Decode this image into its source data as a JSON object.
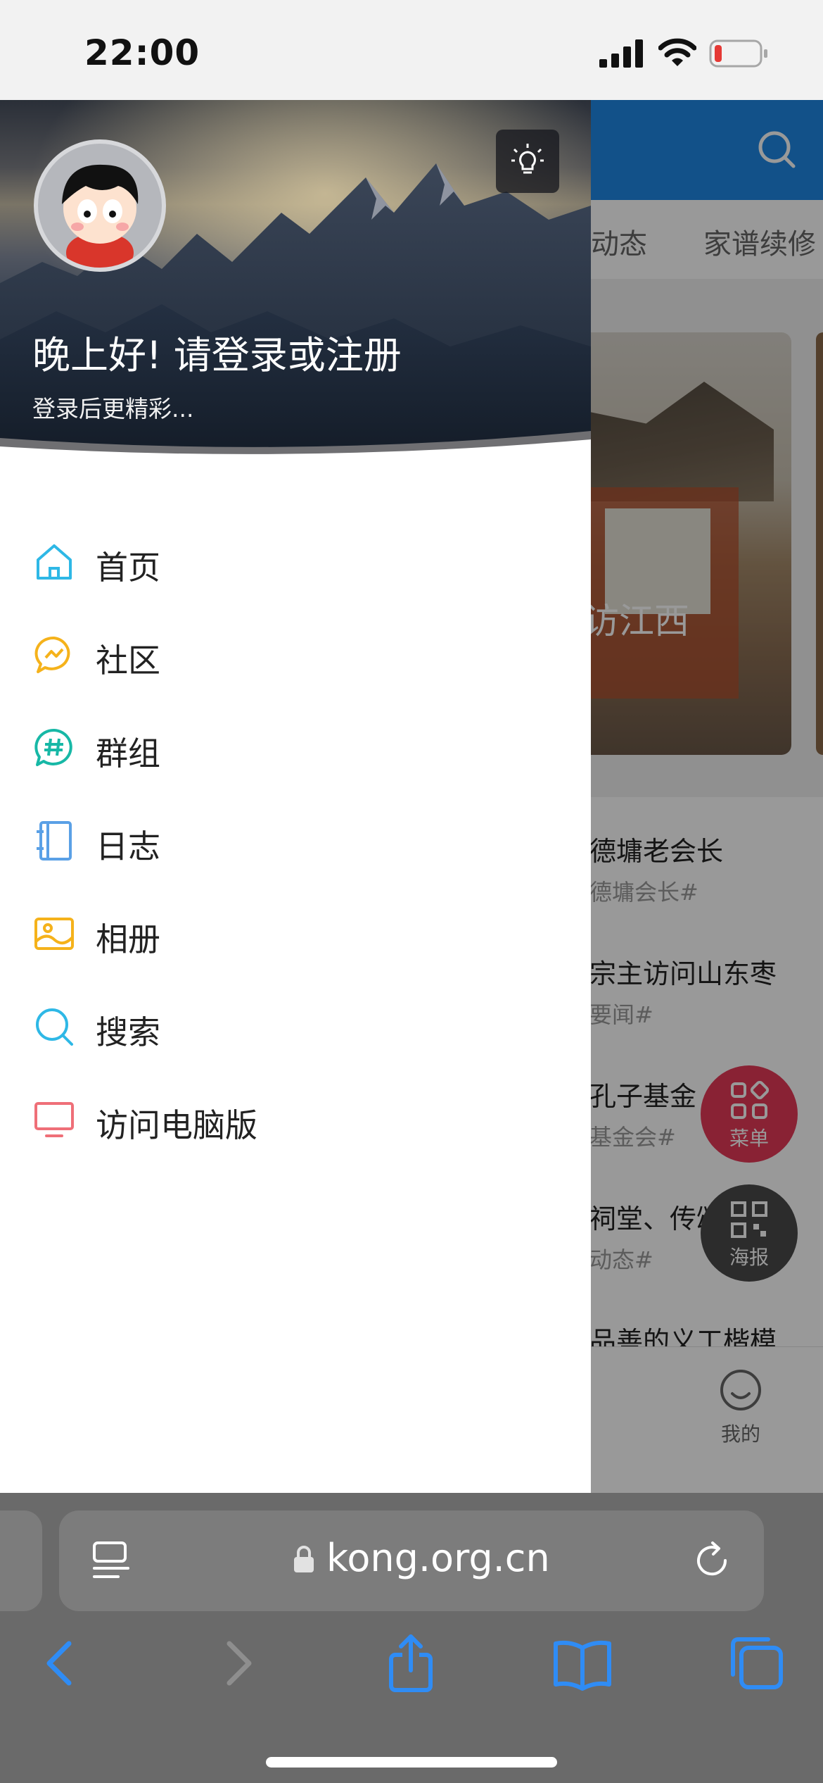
{
  "status_bar": {
    "time": "22:00"
  },
  "background_page": {
    "tabs": [
      "动态",
      "家谱续修"
    ],
    "banner_caption": "立到访江西",
    "news": [
      {
        "title": "德墉老会长",
        "tag": "德墉会长#"
      },
      {
        "title": "宗主访问山东枣",
        "tag": "要闻#"
      },
      {
        "title": "孔子基金",
        "tag": "基金会#"
      },
      {
        "title": "祠堂、传颂家风",
        "tag": "动态#"
      },
      {
        "title": "品善的义工楷模",
        "tag": ""
      }
    ],
    "bottom_nav": {
      "mine_label": "我的"
    },
    "fab_menu_label": "菜单",
    "fab_poster_label": "海报"
  },
  "drawer": {
    "greeting": "晚上好! 请登录或注册",
    "subtitle": "登录后更精彩...",
    "menu": [
      {
        "label": "首页",
        "icon": "home-icon",
        "color": "#2eb8e6"
      },
      {
        "label": "社区",
        "icon": "chat-icon",
        "color": "#f5b21b"
      },
      {
        "label": "群组",
        "icon": "hashtag-chat-icon",
        "color": "#17b8a6"
      },
      {
        "label": "日志",
        "icon": "notebook-icon",
        "color": "#5aa0e6"
      },
      {
        "label": "相册",
        "icon": "photo-icon",
        "color": "#f5b21b"
      },
      {
        "label": "搜索",
        "icon": "search-icon",
        "color": "#2eb8e6"
      },
      {
        "label": "访问电脑版",
        "icon": "monitor-icon",
        "color": "#ef6f78"
      }
    ]
  },
  "browser": {
    "url": "kong.org.cn"
  },
  "colors": {
    "brand_blue": "#1e88e5",
    "fab_red": "#e53957",
    "browser_gray": "#6a6a6a"
  }
}
